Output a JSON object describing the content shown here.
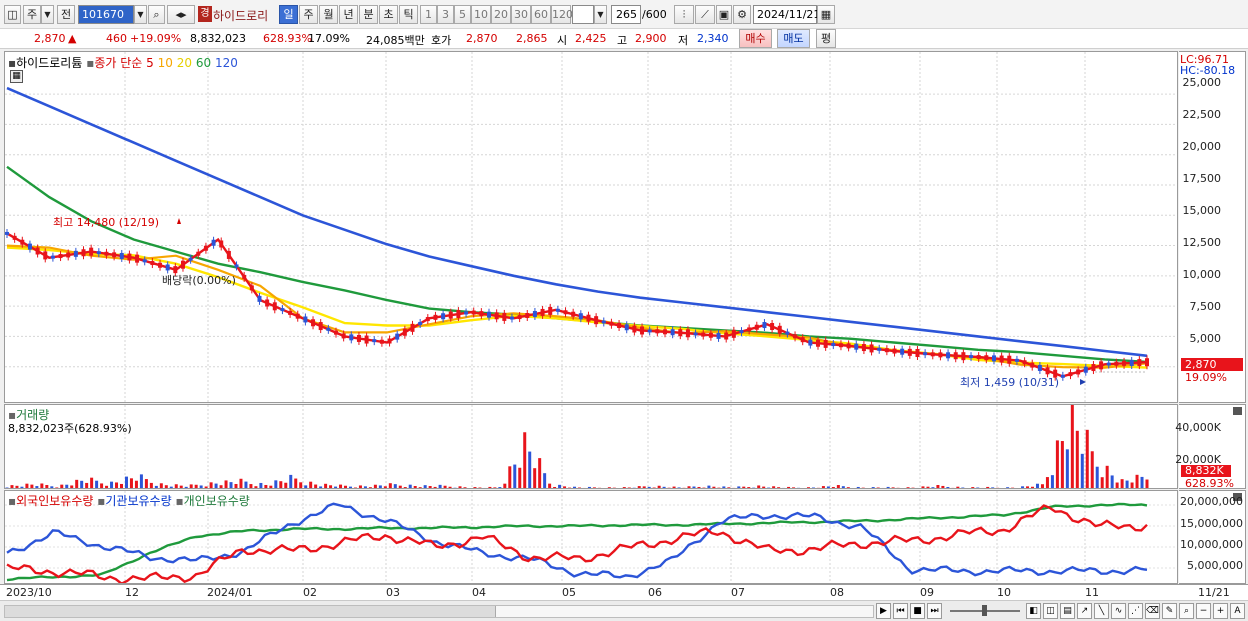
{
  "toolbar": {
    "market_label": "주",
    "prev_label": "전",
    "stock_code": "101670",
    "stock_tag": "경",
    "stock_name": "하이드로리",
    "periods": [
      "일",
      "주",
      "월",
      "년",
      "분",
      "초",
      "틱"
    ],
    "active_period": "일",
    "minute_steps": [
      "1",
      "3",
      "5",
      "10",
      "20",
      "30",
      "60",
      "120"
    ],
    "count_value": "265",
    "count_total": "/600",
    "date_value": "2024/11/21"
  },
  "quote": {
    "price": "2,870",
    "arrow": "▲",
    "change": "460",
    "change_pct": "+19.09%",
    "volume": "8,832,023",
    "volume_ratio": "628.93%",
    "turnover": "17.09%",
    "amount": "24,085백만",
    "bid_label": "호가",
    "ask_price": "2,870",
    "bid_price": "2,865",
    "open_label": "시",
    "open": "2,425",
    "high_label": "고",
    "high": "2,900",
    "low_label": "저",
    "low": "2,340",
    "buy_label": "매수",
    "sell_label": "매도",
    "eval_label": "평"
  },
  "price_panel": {
    "title": "하이드로리튬",
    "ma_label": "종가 단순",
    "ma_periods": [
      "5",
      "10",
      "20",
      "60",
      "120"
    ],
    "lc_label": "LC:96.71",
    "hc_label": "HC:-80.18",
    "y_ticks": [
      "25,000",
      "22,500",
      "20,000",
      "17,500",
      "15,000",
      "12,500",
      "10,000",
      "7,500",
      "5,000"
    ],
    "high_annotation": "최고 14,480 (12/19)",
    "dividend_annotation": "배당락(0.00%)",
    "low_annotation": "최저 1,459 (10/31)",
    "last_price_tag": "2,870",
    "last_pct_tag": "19.09%",
    "colors": {
      "ma5": "#e8141b",
      "ma10": "#f7a600",
      "ma20": "#ffe600",
      "ma60": "#1f9a3c",
      "ma120": "#2c55d8"
    }
  },
  "volume_panel": {
    "title": "거래량",
    "value_label": "8,832,023주(628.93%)",
    "y_ticks": [
      "40,000K",
      "20,000K"
    ],
    "last_tag": "8,832K",
    "last_pct": "628.93%"
  },
  "holding_panel": {
    "series_names": [
      "외국인보유수량",
      "기관보유수량",
      "개인보유수량"
    ],
    "y_ticks": [
      "20,000,000",
      "15,000,000",
      "10,000,000",
      "5,000,000"
    ],
    "colors": {
      "foreign": "#e8141b",
      "institution": "#2c55d8",
      "individual": "#1f9a3c"
    }
  },
  "x_axis": {
    "labels": [
      "2023/10",
      "12",
      "2024/01",
      "02",
      "03",
      "04",
      "05",
      "06",
      "07",
      "08",
      "09",
      "10",
      "11"
    ],
    "right_label": "11/21"
  },
  "chart_data": {
    "type": "line",
    "series": [
      {
        "name": "120",
        "values": [
          25500,
          24000,
          22500,
          21000,
          19500,
          18000,
          16500,
          15000,
          13800,
          12600,
          11600,
          10800,
          10000,
          9300,
          8700,
          8200,
          7800,
          7400,
          7000,
          6600,
          6200,
          5800,
          5400,
          5000,
          4600,
          4200,
          3800,
          3400
        ]
      },
      {
        "name": "60",
        "values": [
          19000,
          16500,
          14500,
          13000,
          12000,
          11000,
          10300,
          9500,
          8800,
          8000,
          7300,
          7000,
          6800,
          6500,
          6200,
          5900,
          5700,
          5500,
          5300,
          5000,
          4800,
          4500,
          4200,
          3900,
          3700,
          3400,
          3100,
          2900
        ]
      },
      {
        "name": "5",
        "values": [
          13500,
          11500,
          12000,
          11500,
          10500,
          13000,
          8000,
          6500,
          5000,
          4500,
          6500,
          7000,
          6500,
          7200,
          6300,
          5500,
          5300,
          5000,
          6000,
          4500,
          4200,
          3800,
          3500,
          3300,
          3000,
          1700,
          2700,
          2870
        ]
      }
    ],
    "ylim": [
      0,
      26000
    ],
    "volume_values": [
      2,
      3,
      2,
      6,
      4,
      8,
      3,
      2,
      4,
      5,
      3,
      7,
      3,
      2,
      2,
      3,
      2,
      2,
      1,
      1,
      30,
      3,
      1,
      1,
      1,
      2,
      1,
      2,
      1,
      2,
      1,
      1,
      2,
      1,
      1,
      1,
      2,
      1,
      1,
      1,
      3,
      48,
      20,
      5,
      8
    ]
  }
}
